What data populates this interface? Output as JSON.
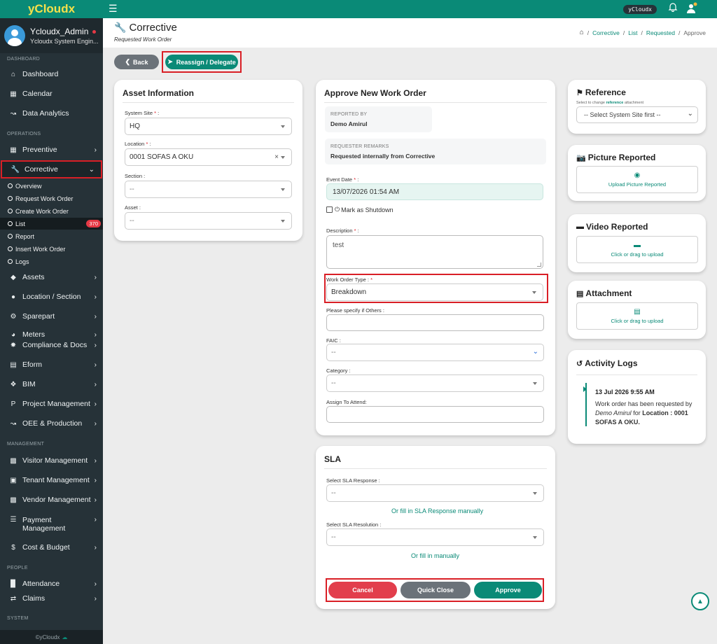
{
  "brand": "yCloudx",
  "user": {
    "name": "Ycloudx_Admin",
    "role": "Ycloudx System Engin..."
  },
  "sidebar": {
    "sections": [
      "DASHBOARD",
      "OPERATIONS",
      "MANAGEMENT",
      "PEOPLE",
      "SYSTEM"
    ],
    "items": [
      {
        "label": "Dashboard",
        "icon": "home-icon"
      },
      {
        "label": "Calendar",
        "icon": "calendar-icon"
      },
      {
        "label": "Data Analytics",
        "icon": "chart-icon"
      },
      {
        "label": "Preventive",
        "icon": "calendar-icon"
      },
      {
        "label": "Corrective",
        "icon": "wrench-icon"
      },
      {
        "label": "Assets",
        "icon": "tag-icon"
      },
      {
        "label": "Location / Section",
        "icon": "pin-icon"
      },
      {
        "label": "Sparepart",
        "icon": "gear-icon"
      },
      {
        "label": "Meters",
        "icon": "gauge-icon"
      },
      {
        "label": "Compliance & Docs",
        "icon": "badge-icon"
      },
      {
        "label": "Eform",
        "icon": "form-icon"
      },
      {
        "label": "BIM",
        "icon": "cube-icon"
      },
      {
        "label": "Project Management",
        "icon": "project-icon"
      },
      {
        "label": "OEE & Production",
        "icon": "chart-icon"
      },
      {
        "label": "Visitor Management",
        "icon": "visitor-icon"
      },
      {
        "label": "Tenant Management",
        "icon": "building-icon"
      },
      {
        "label": "Vendor Management",
        "icon": "vendor-icon"
      },
      {
        "label": "Payment",
        "label2": "Management",
        "icon": "cart-icon"
      },
      {
        "label": "Cost & Budget",
        "icon": "dollar-icon"
      },
      {
        "label": "Attendance",
        "icon": "attendance-icon"
      },
      {
        "label": "Claims",
        "icon": "claims-icon"
      }
    ],
    "sub_items": [
      "Overview",
      "Request Work Order",
      "Create Work Order",
      "List",
      "Report",
      "Insert Work Order",
      "Logs"
    ],
    "list_badge": "370",
    "footer": "©yCloudx"
  },
  "topbar": {
    "chip": "yCloudx"
  },
  "header": {
    "title": "Corrective",
    "subtitle": "Requested Work Order",
    "breadcrumb": [
      "Corrective",
      "List",
      "Requested",
      "Approve"
    ]
  },
  "buttons": {
    "back": "Back",
    "reassign": "Reassign / Delegate"
  },
  "asset_info": {
    "title": "Asset Information",
    "system_site_label": "System Site",
    "system_site_value": "HQ",
    "location_label": "Location",
    "location_value": "0001 SOFAS A OKU",
    "section_label": "Section",
    "section_value": "--",
    "asset_label": "Asset",
    "asset_value": "--"
  },
  "approve": {
    "title": "Approve New Work Order",
    "reported_by_label": "REPORTED BY",
    "reported_by_value": "Demo Amirul",
    "remarks_label": "REQUESTER REMARKS",
    "remarks_value": "Requested internally from Corrective",
    "event_date_label": "Event Date",
    "event_date_value": "13/07/2026 01:54 AM",
    "shutdown_label": "Mark as Shutdown",
    "description_label": "Description",
    "description_value": "test",
    "wo_type_label": "Work Order Type :",
    "wo_type_value": "Breakdown",
    "others_label": "Please specify if Others :",
    "faic_label": "FAIC :",
    "faic_value": "--",
    "category_label": "Category :",
    "category_value": "--",
    "assign_label": "Assign To Attend:"
  },
  "sla": {
    "title": "SLA",
    "response_label": "Select SLA Response :",
    "response_value": "--",
    "response_manual": "Or fill in SLA Response manually",
    "resolution_label": "Select SLA Resolution :",
    "resolution_value": "--",
    "resolution_manual": "Or fill in manually",
    "cancel": "Cancel",
    "quick_close": "Quick Close",
    "approve": "Approve"
  },
  "reference": {
    "title": "Reference",
    "hint_pre": "Select to change ",
    "hint_bold": "reference",
    "hint_post": " attachment",
    "select_value": "-- Select System Site first --"
  },
  "picture": {
    "title": "Picture Reported",
    "upload": "Upload Picture Reported"
  },
  "video": {
    "title": "Video Reported",
    "upload": "Click or drag to upload"
  },
  "attachment": {
    "title": "Attachment",
    "upload": "Click or drag to upload"
  },
  "activity": {
    "title": "Activity Logs",
    "date": "13 Jul 2026 9:55 AM",
    "text_pre": "Work order has been requested by ",
    "text_user": "Demo Amirul",
    "text_mid": " for ",
    "text_bold": "Location : 0001 SOFAS A OKU."
  },
  "colors": {
    "brand": "#0a8a77",
    "danger": "#e23e4c",
    "secondary": "#6b7279",
    "sidebar": "#263238"
  }
}
